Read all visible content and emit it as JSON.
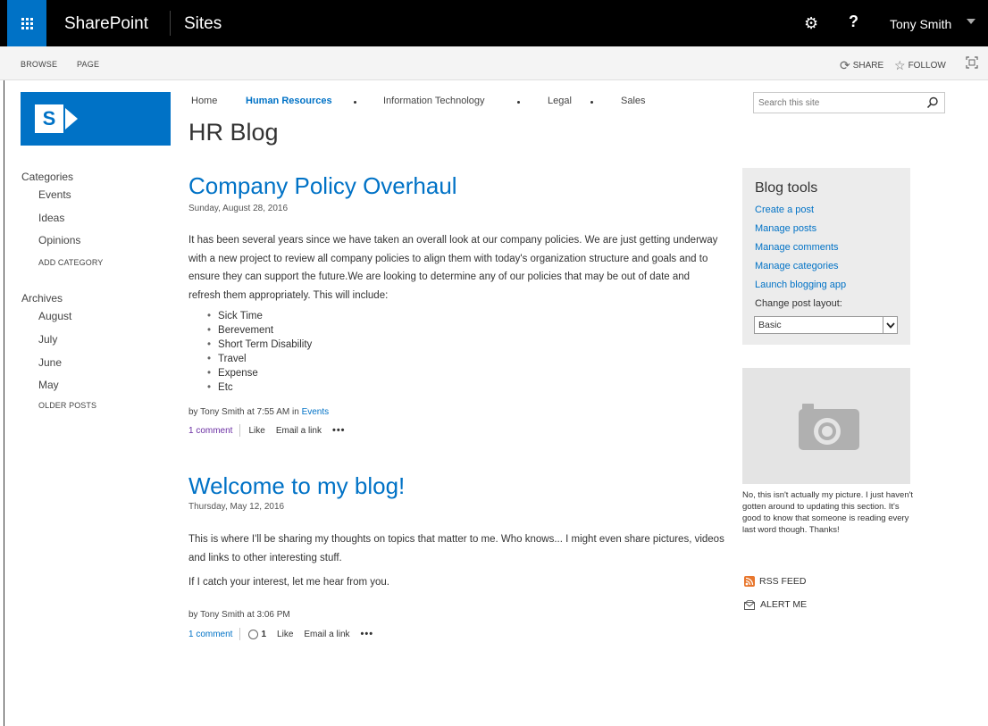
{
  "suitebar": {
    "brand": "SharePoint",
    "sites": "Sites",
    "help": "?",
    "user": "Tony Smith"
  },
  "ribbon": {
    "tabs": [
      "BROWSE",
      "PAGE"
    ],
    "share": "SHARE",
    "follow": "FOLLOW"
  },
  "logo": {
    "letter": "S"
  },
  "left_nav": {
    "categories_heading": "Categories",
    "categories": [
      "Events",
      "Ideas",
      "Opinions"
    ],
    "add_category": "ADD CATEGORY",
    "archives_heading": "Archives",
    "archives": [
      "August",
      "July",
      "June",
      "May"
    ],
    "older_posts": "OLDER POSTS"
  },
  "top_nav": {
    "items": [
      "Home",
      "Human Resources",
      "Information Technology",
      "Legal",
      "Sales"
    ],
    "active": "Human Resources"
  },
  "page_title": "HR Blog",
  "search": {
    "placeholder": "Search this site"
  },
  "posts": [
    {
      "title": "Company Policy Overhaul",
      "date": "Sunday, August 28, 2016",
      "body": "It has been several years since we have taken an overall look at our company policies. We are just getting underway with a new project to review all company policies to align them with today's organization structure and goals and to ensure they can support the future.We are looking to determine any of our policies that may be out of date and refresh them appropriately. This will include:",
      "list": [
        "Sick Time",
        "Berevement",
        "Short Term Disability",
        "Travel",
        "Expense",
        "Etc"
      ],
      "byline_prefix": "by Tony Smith at 7:55 AM in ",
      "byline_category": "Events",
      "comments": "1 comment",
      "like": "Like",
      "email": "Email a link",
      "more": "•••"
    },
    {
      "title": "Welcome to my blog!",
      "date": "Thursday, May 12, 2016",
      "body1": "This is where I'll be sharing my thoughts on topics that matter to me. Who knows... I might even share pictures, videos and links to other interesting stuff.",
      "body2": "If I catch your interest, let me hear from you.",
      "byline_prefix": "by Tony Smith at 3:06 PM",
      "comments": "1 comment",
      "likes_count": "1",
      "like": "Like",
      "email": "Email a link",
      "more": "•••"
    }
  ],
  "blog_tools": {
    "title": "Blog tools",
    "links": [
      "Create a post",
      "Manage posts",
      "Manage comments",
      "Manage categories",
      "Launch blogging app"
    ],
    "layout_label": "Change post layout:",
    "layout_value": "Basic"
  },
  "photo_caption": "No, this isn't actually my picture. I just haven't gotten around to updating this section. It's good to know that someone is reading every last word though. Thanks!",
  "rss": "RSS FEED",
  "alert": "ALERT ME",
  "colors": {
    "brand_blue": "#0072c6",
    "suitebar": "#000000",
    "visited": "#6b2fa3"
  }
}
